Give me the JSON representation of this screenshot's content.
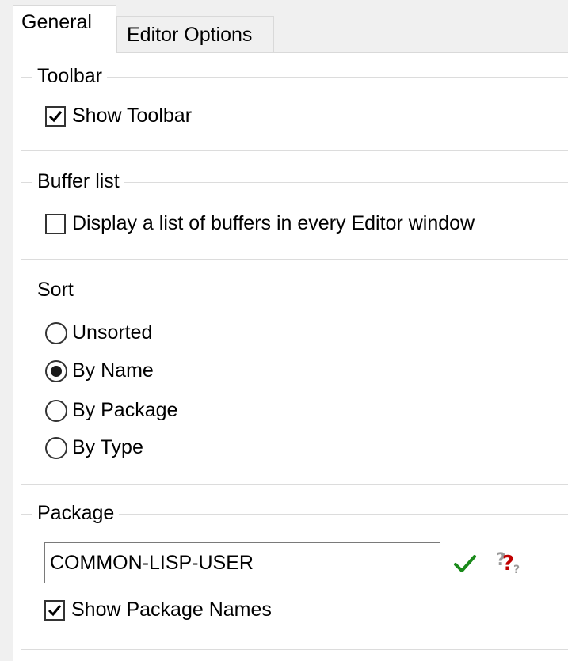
{
  "tabs": [
    {
      "label": "General",
      "active": true
    },
    {
      "label": "Editor Options",
      "active": false
    }
  ],
  "toolbar_group": {
    "legend": "Toolbar",
    "show_toolbar": {
      "label": "Show Toolbar",
      "checked": true
    }
  },
  "buffer_group": {
    "legend": "Buffer list",
    "display_list": {
      "label": "Display a list of buffers in every Editor window",
      "checked": false
    }
  },
  "sort_group": {
    "legend": "Sort",
    "options": [
      {
        "label": "Unsorted",
        "selected": false
      },
      {
        "label": "By Name",
        "selected": true
      },
      {
        "label": "By Package",
        "selected": false
      },
      {
        "label": "By Type",
        "selected": false
      }
    ]
  },
  "package_group": {
    "legend": "Package",
    "package_value": "COMMON-LISP-USER",
    "confirm_icon": "green-checkmark-icon",
    "help_icon": "help-question-icon",
    "show_package_names": {
      "label": "Show Package Names",
      "checked": true
    }
  },
  "colors": {
    "confirm": "#1a8a1a",
    "help": "#c00000"
  }
}
